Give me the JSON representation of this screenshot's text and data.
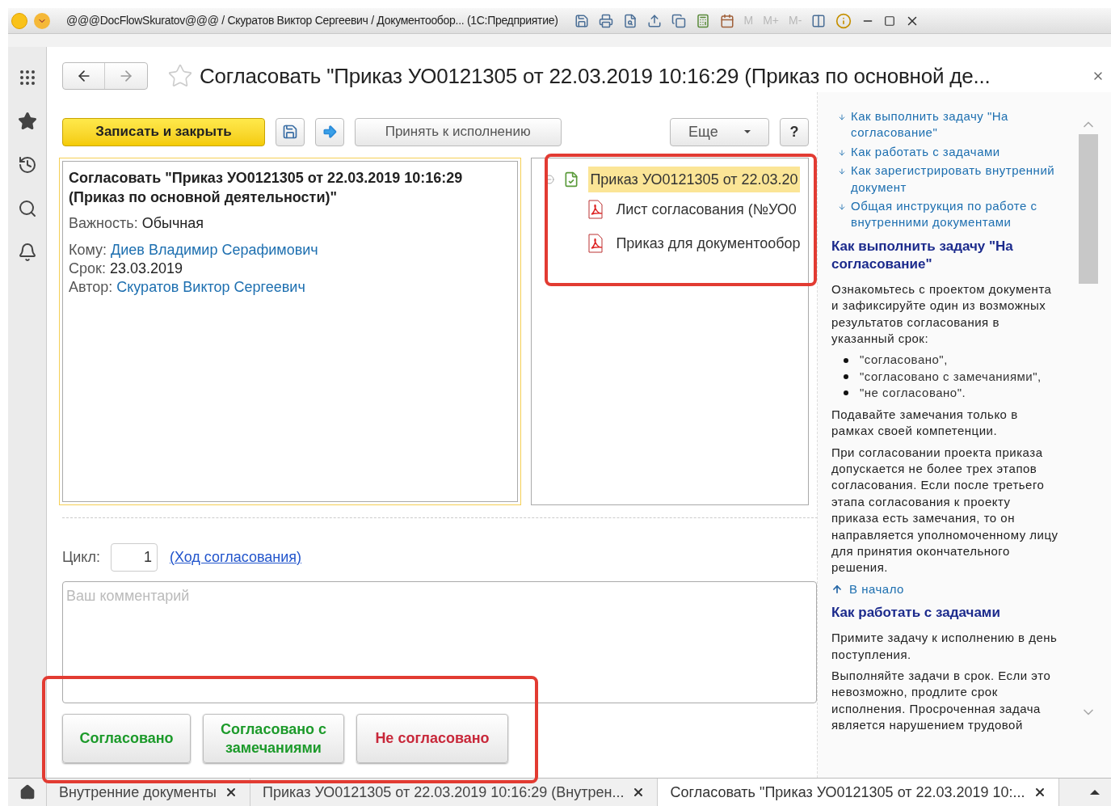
{
  "window": {
    "title": "@@@DocFlowSkuratov@@@ / Скуратов Виктор Сергеевич / Документообор... (1С:Предприятие)",
    "calc_buttons": [
      "M",
      "M+",
      "M-"
    ]
  },
  "form": {
    "title": "Согласовать \"Приказ УО0121305 от 22.03.2019 10:16:29 (Приказ по основной де...",
    "starred": false
  },
  "toolbar": {
    "primary": "Записать и закрыть",
    "accept": "Принять к исполнению",
    "more": "Еще",
    "help": "?"
  },
  "task": {
    "heading": "Согласовать \"Приказ УО0121305 от 22.03.2019 10:16:29 (Приказ по основной деятельности)\"",
    "fields": [
      {
        "label": "Важность:",
        "value": "Обычная",
        "kind": "text"
      },
      {
        "label": "Кому:",
        "value": "Диев Владимир Серафимович",
        "kind": "link"
      },
      {
        "label": "Срок:",
        "value": "23.03.2019",
        "kind": "text"
      },
      {
        "label": "Автор:",
        "value": "Скуратов Виктор Сергеевич",
        "kind": "link"
      }
    ]
  },
  "attachments": [
    {
      "label": "Приказ УО0121305 от 22.03.20",
      "kind": "document",
      "selected": true,
      "expanded": true,
      "children": [
        {
          "label": "Лист согласования (№УО0",
          "kind": "pdf",
          "selected": false
        },
        {
          "label": "Приказ для документообор",
          "kind": "pdf",
          "selected": false
        }
      ]
    }
  ],
  "cycle": {
    "label": "Цикл:",
    "value": "1",
    "link": "(Ход согласования)"
  },
  "comment": {
    "placeholder": "Ваш комментарий"
  },
  "decision_buttons": [
    {
      "label": "Согласовано",
      "kind": "approve"
    },
    {
      "label": "Согласовано с замечаниями",
      "kind": "approve"
    },
    {
      "label": "Не согласовано",
      "kind": "reject"
    }
  ],
  "help": {
    "toc": [
      "Как выполнить задачу \"На согласование\"",
      "Как работать с задачами",
      "Как зарегистрировать внутренний документ",
      "Общая инструкция по работе с внутренними документами"
    ],
    "sections": [
      {
        "heading": "Как выполнить задачу \"На согласование\"",
        "blocks": [
          {
            "kind": "p",
            "text": "Ознакомьтесь с проектом документа и зафиксируйте один из возможных результатов согласования в указанный срок:"
          },
          {
            "kind": "list",
            "items": [
              "\"согласовано\",",
              "\"согласовано с замечаниями\",",
              "\"не согласовано\"."
            ]
          },
          {
            "kind": "p",
            "text": "Подавайте замечания только в рамках своей компетенции."
          },
          {
            "kind": "p",
            "text": "При согласовании проекта приказа допускается не более трех этапов согласования. Если после третьего этапа согласования к проекту приказа есть замечания, то он направляется уполномоченному лицу для принятия окончательного решения."
          }
        ],
        "back_link": "В начало"
      },
      {
        "heading": "Как работать с задачами",
        "blocks": [
          {
            "kind": "p",
            "text": "Примите задачу к исполнению в день поступления."
          },
          {
            "kind": "p",
            "text": "Выполняйте задачи в срок. Если это невозможно, продлите срок исполнения. Просроченная задача является нарушением трудовой"
          }
        ]
      }
    ]
  },
  "open_tabs": [
    {
      "label": "Внутренние документы",
      "selected": false
    },
    {
      "label": "Приказ УО0121305 от 22.03.2019 10:16:29 (Внутрен...",
      "selected": false
    },
    {
      "label": "Согласовать \"Приказ УО0121305 от 22.03.2019 10:...",
      "selected": true
    }
  ]
}
